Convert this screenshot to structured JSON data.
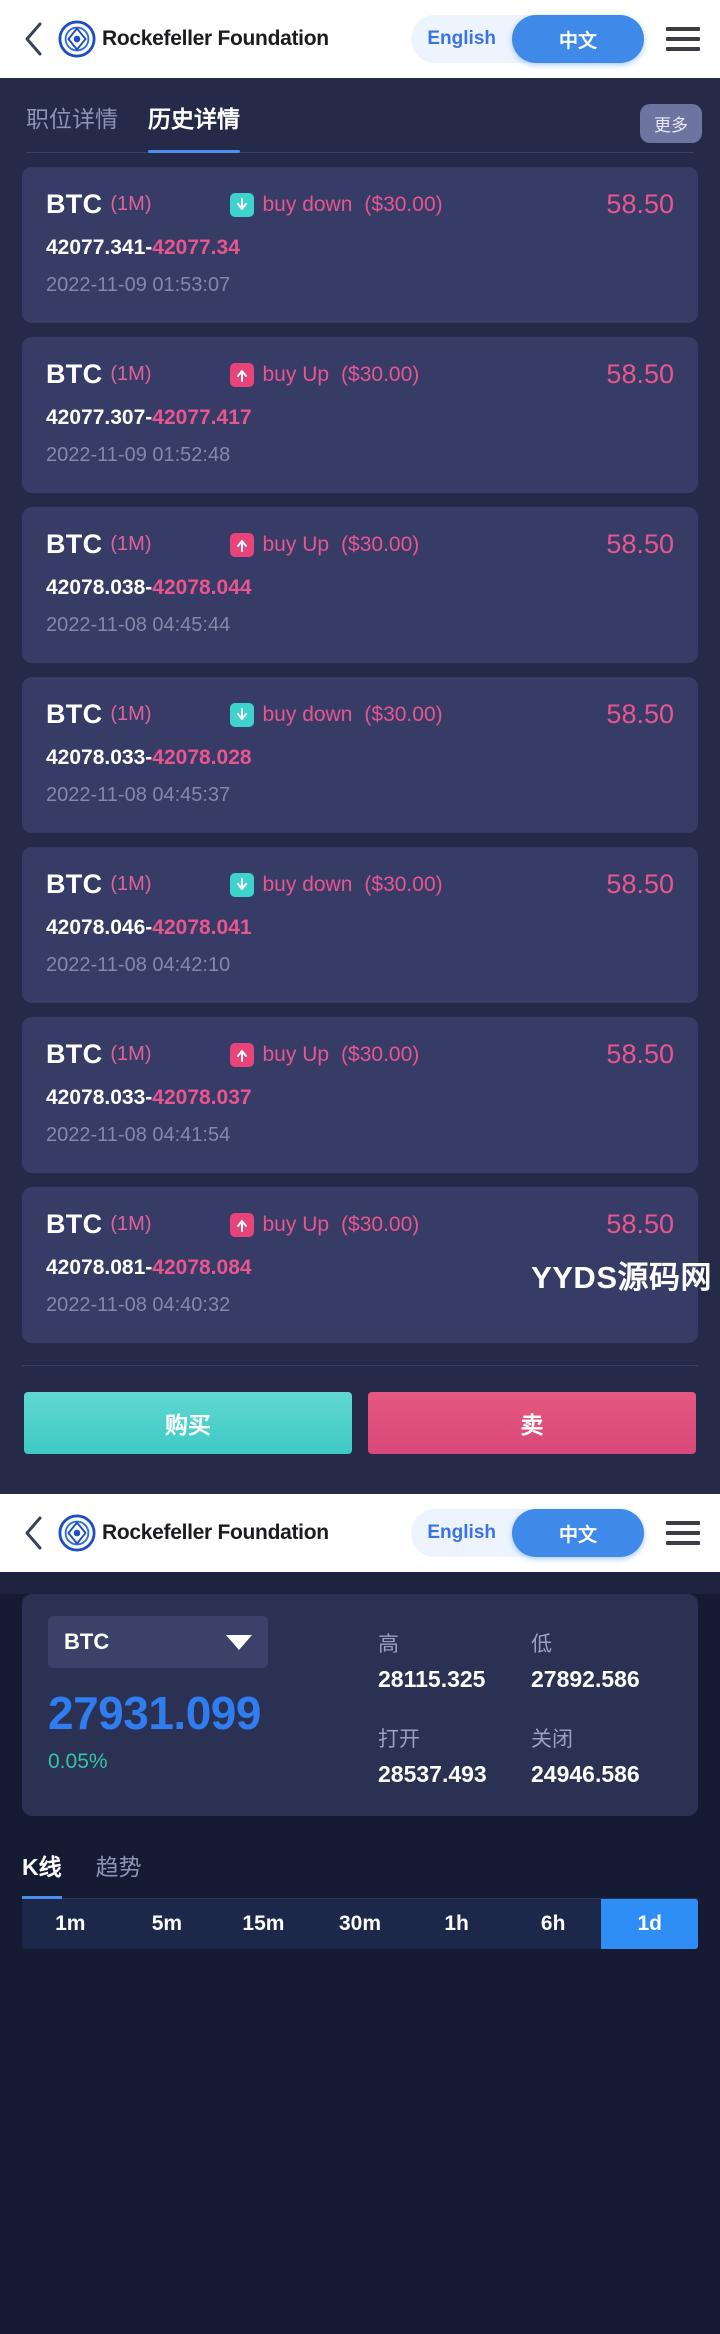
{
  "header": {
    "back_icon": "chevron-left-icon",
    "logo_icon": "rockefeller-logo-icon",
    "brand": "Rockefeller Foundation",
    "lang_en": "English",
    "lang_zh": "中文",
    "menu_icon": "hamburger-menu-icon",
    "accent": "#3f8ae8"
  },
  "tabs": {
    "position_detail": "职位详情",
    "history_detail": "历史详情",
    "more": "更多",
    "active_index": 1
  },
  "trades": [
    {
      "symbol": "BTC",
      "period": "(1M)",
      "direction": "buy down",
      "direction_icon": "arrow-down-icon",
      "amount": "($30.00)",
      "profit": "58.50",
      "open_price": "42077.341",
      "close_price": "42077.34",
      "time": "2022-11-09 01:53:07"
    },
    {
      "symbol": "BTC",
      "period": "(1M)",
      "direction": "buy Up",
      "direction_icon": "arrow-up-icon",
      "amount": "($30.00)",
      "profit": "58.50",
      "open_price": "42077.307",
      "close_price": "42077.417",
      "time": "2022-11-09 01:52:48"
    },
    {
      "symbol": "BTC",
      "period": "(1M)",
      "direction": "buy Up",
      "direction_icon": "arrow-up-icon",
      "amount": "($30.00)",
      "profit": "58.50",
      "open_price": "42078.038",
      "close_price": "42078.044",
      "time": "2022-11-08 04:45:44"
    },
    {
      "symbol": "BTC",
      "period": "(1M)",
      "direction": "buy down",
      "direction_icon": "arrow-down-icon",
      "amount": "($30.00)",
      "profit": "58.50",
      "open_price": "42078.033",
      "close_price": "42078.028",
      "time": "2022-11-08 04:45:37"
    },
    {
      "symbol": "BTC",
      "period": "(1M)",
      "direction": "buy down",
      "direction_icon": "arrow-down-icon",
      "amount": "($30.00)",
      "profit": "58.50",
      "open_price": "42078.046",
      "close_price": "42078.041",
      "time": "2022-11-08 04:42:10"
    },
    {
      "symbol": "BTC",
      "period": "(1M)",
      "direction": "buy Up",
      "direction_icon": "arrow-up-icon",
      "amount": "($30.00)",
      "profit": "58.50",
      "open_price": "42078.033",
      "close_price": "42078.037",
      "time": "2022-11-08 04:41:54"
    },
    {
      "symbol": "BTC",
      "period": "(1M)",
      "direction": "buy Up",
      "direction_icon": "arrow-up-icon",
      "amount": "($30.00)",
      "profit": "58.50",
      "open_price": "42078.081",
      "close_price": "42078.084",
      "time": "2022-11-08 04:40:32"
    }
  ],
  "watermark": "YYDS源码网",
  "actions": {
    "buy": "购买",
    "sell": "卖",
    "buy_color": "#3fc9c6",
    "sell_color": "#d9487a"
  },
  "quote": {
    "symbol": "BTC",
    "dropdown_icon": "chevron-down-icon",
    "last_price": "27931.099",
    "change_pct": "0.05%",
    "price_color": "#2f7df0",
    "change_color": "#35c3a6",
    "stats": [
      {
        "label": "高",
        "value": "28115.325"
      },
      {
        "label": "低",
        "value": "27892.586"
      },
      {
        "label": "打开",
        "value": "28537.493"
      },
      {
        "label": "关闭",
        "value": "24946.586"
      }
    ]
  },
  "chart": {
    "tabs": [
      "K线",
      "趋势"
    ],
    "active_tab_index": 0,
    "timeframes": [
      "1m",
      "5m",
      "15m",
      "30m",
      "1h",
      "6h",
      "1d"
    ],
    "active_timeframe": "1d",
    "active_timeframe_color": "#2f8ef5"
  }
}
